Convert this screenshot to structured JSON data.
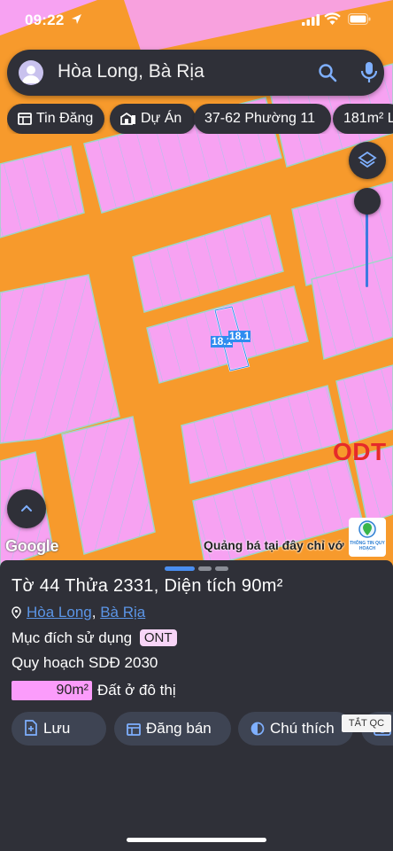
{
  "status_bar": {
    "time": "09:22"
  },
  "search": {
    "query": "Hòa Long, Bà Rịa"
  },
  "chips": [
    {
      "label": "Tin Đăng",
      "icon": "listing-icon"
    },
    {
      "label": "Dự Án",
      "icon": "building-icon"
    },
    {
      "label": "37-62 Phường 11",
      "icon": ""
    },
    {
      "label": "181m² L",
      "icon": ""
    }
  ],
  "map": {
    "plot_labels": [
      "18.1",
      "18.1"
    ],
    "zone_label": "ODT",
    "google_logo": "Google",
    "ad_text": "Quảng bá tại đây chỉ vớ",
    "qh_logo_text": "THÔNG TIN QUY HOẠCH",
    "colors": {
      "land": "#f7a2f2",
      "road": "#f79a2c",
      "selection": "#2f8cf0"
    }
  },
  "sheet": {
    "title": "Tờ 44 Thửa 2331, Diện tích 90m²",
    "address": {
      "ward": "Hòa Long",
      "separator": ", ",
      "city": "Bà Rịa"
    },
    "usage_label": "Mục đích sử dụng",
    "usage_code": "ONT",
    "plan_label": "Quy hoạch SDĐ 2030",
    "plan_area": "90m²",
    "plan_type": "Đất ở đô thị",
    "actions": [
      {
        "label": "Lưu",
        "icon": "add-note-icon"
      },
      {
        "label": "Đăng bán",
        "icon": "listing-icon"
      },
      {
        "label": "Chú thích",
        "icon": "contrast-icon"
      },
      {
        "label": "",
        "icon": "camera-icon"
      }
    ],
    "ad_close": "TẮT QC"
  }
}
